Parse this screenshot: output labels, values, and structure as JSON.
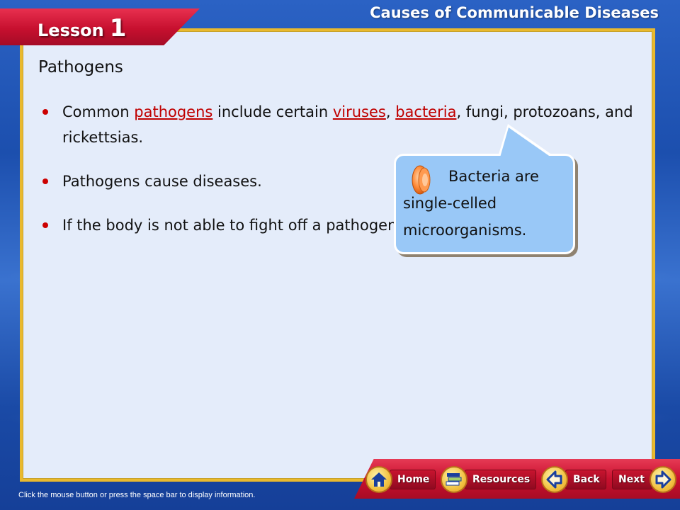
{
  "lesson": {
    "word": "Lesson",
    "number": "1"
  },
  "title": "Causes of Communicable Diseases",
  "heading": "Pathogens",
  "bullets": {
    "b1": {
      "t1": "Common ",
      "link_pathogens": "pathogens",
      "t2": " include certain ",
      "link_viruses": "viruses",
      "t3": ", ",
      "link_bacteria": "bacteria",
      "t4": ", fungi, protozoans, and rickettsias."
    },
    "b2": "Pathogens cause diseases.",
    "b3": "If the body is not able to fight off a pathogen, a disease develops."
  },
  "callout": {
    "line1": "Bacteria are",
    "line2": "single-celled",
    "line3": "microorganisms.",
    "icon": "speaker-icon"
  },
  "nav": {
    "home": "Home",
    "resources": "Resources",
    "back": "Back",
    "next": "Next"
  },
  "status_text": "Click the mouse button or press the space bar to display information.",
  "colors": {
    "accent_red": "#c8102e",
    "link_red": "#c00000",
    "panel_bg": "#e4ecfa",
    "panel_border": "#e9b92e",
    "callout_bg": "#99c8f7"
  }
}
